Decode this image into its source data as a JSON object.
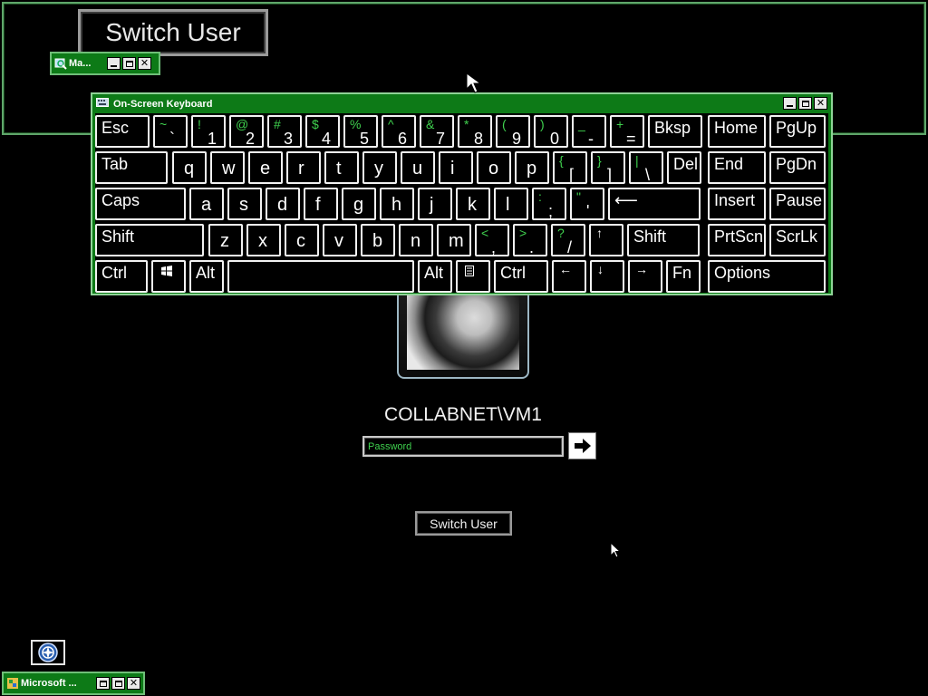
{
  "magnifier": {
    "zoomed_text": "Switch User"
  },
  "mag_window": {
    "title": "Ma..."
  },
  "osk": {
    "title": "On-Screen Keyboard",
    "rows": [
      [
        {
          "type": "main",
          "main": "Esc"
        },
        {
          "type": "dual",
          "up": "~",
          "lo": "`"
        },
        {
          "type": "dual",
          "up": "!",
          "lo": "1"
        },
        {
          "type": "dual",
          "up": "@",
          "lo": "2"
        },
        {
          "type": "dual",
          "up": "#",
          "lo": "3"
        },
        {
          "type": "dual",
          "up": "$",
          "lo": "4"
        },
        {
          "type": "dual",
          "up": "%",
          "lo": "5"
        },
        {
          "type": "dual",
          "up": "^",
          "lo": "6"
        },
        {
          "type": "dual",
          "up": "&",
          "lo": "7"
        },
        {
          "type": "dual",
          "up": "*",
          "lo": "8"
        },
        {
          "type": "dual",
          "up": "(",
          "lo": "9"
        },
        {
          "type": "dual",
          "up": ")",
          "lo": "0"
        },
        {
          "type": "dual",
          "up": "_",
          "lo": "-"
        },
        {
          "type": "dual",
          "up": "+",
          "lo": "="
        },
        {
          "type": "main",
          "main": "Bksp"
        },
        {
          "type": "main",
          "main": "Home"
        },
        {
          "type": "main",
          "main": "PgUp"
        }
      ],
      [
        {
          "type": "main",
          "main": "Tab"
        },
        {
          "type": "letter",
          "main": "q"
        },
        {
          "type": "letter",
          "main": "w"
        },
        {
          "type": "letter",
          "main": "e"
        },
        {
          "type": "letter",
          "main": "r"
        },
        {
          "type": "letter",
          "main": "t"
        },
        {
          "type": "letter",
          "main": "y"
        },
        {
          "type": "letter",
          "main": "u"
        },
        {
          "type": "letter",
          "main": "i"
        },
        {
          "type": "letter",
          "main": "o"
        },
        {
          "type": "letter",
          "main": "p"
        },
        {
          "type": "dual",
          "up": "{",
          "lo": "["
        },
        {
          "type": "dual",
          "up": "}",
          "lo": "]"
        },
        {
          "type": "dual",
          "up": "|",
          "lo": "\\"
        },
        {
          "type": "main",
          "main": "Del"
        },
        {
          "type": "main",
          "main": "End"
        },
        {
          "type": "main",
          "main": "PgDn"
        }
      ],
      [
        {
          "type": "main",
          "main": "Caps"
        },
        {
          "type": "letter",
          "main": "a"
        },
        {
          "type": "letter",
          "main": "s"
        },
        {
          "type": "letter",
          "main": "d"
        },
        {
          "type": "letter",
          "main": "f"
        },
        {
          "type": "letter",
          "main": "g"
        },
        {
          "type": "letter",
          "main": "h"
        },
        {
          "type": "letter",
          "main": "j"
        },
        {
          "type": "letter",
          "main": "k"
        },
        {
          "type": "letter",
          "main": "l"
        },
        {
          "type": "dual",
          "up": ":",
          "lo": ";"
        },
        {
          "type": "dual",
          "up": "\"",
          "lo": "'"
        },
        {
          "type": "main",
          "main": "⟵"
        },
        {
          "type": "main",
          "main": "Insert"
        },
        {
          "type": "main",
          "main": "Pause"
        }
      ],
      [
        {
          "type": "main",
          "main": "Shift"
        },
        {
          "type": "letter",
          "main": "z"
        },
        {
          "type": "letter",
          "main": "x"
        },
        {
          "type": "letter",
          "main": "c"
        },
        {
          "type": "letter",
          "main": "v"
        },
        {
          "type": "letter",
          "main": "b"
        },
        {
          "type": "letter",
          "main": "n"
        },
        {
          "type": "letter",
          "main": "m"
        },
        {
          "type": "dual",
          "up": "<",
          "lo": ","
        },
        {
          "type": "dual",
          "up": ">",
          "lo": "."
        },
        {
          "type": "dual",
          "up": "?",
          "lo": "/"
        },
        {
          "type": "arrow",
          "main": "↑"
        },
        {
          "type": "main",
          "main": "Shift"
        },
        {
          "type": "main",
          "main": "PrtScn"
        },
        {
          "type": "main",
          "main": "ScrLk"
        }
      ],
      [
        {
          "type": "main",
          "main": "Ctrl"
        },
        {
          "type": "icon",
          "icon": "windows-logo-icon"
        },
        {
          "type": "main",
          "main": "Alt"
        },
        {
          "type": "space",
          "main": ""
        },
        {
          "type": "main",
          "main": "Alt"
        },
        {
          "type": "icon",
          "icon": "menu-key-icon"
        },
        {
          "type": "main",
          "main": "Ctrl"
        },
        {
          "type": "arrow",
          "main": "←"
        },
        {
          "type": "arrow",
          "main": "↓"
        },
        {
          "type": "arrow",
          "main": "→"
        },
        {
          "type": "main",
          "main": "Fn"
        },
        {
          "type": "main",
          "main": "Options"
        }
      ]
    ]
  },
  "login": {
    "username": "COLLABNET\\VM1",
    "password_placeholder": "Password",
    "submit_icon": "arrow-right-icon",
    "switch_user_label": "Switch User"
  },
  "taskbar_window": {
    "title": "Microsoft ..."
  },
  "ease_of_access_icon": "ease-of-access-icon",
  "colors": {
    "window_green": "#0d7a17",
    "shift_text_green": "#3fd14e"
  }
}
